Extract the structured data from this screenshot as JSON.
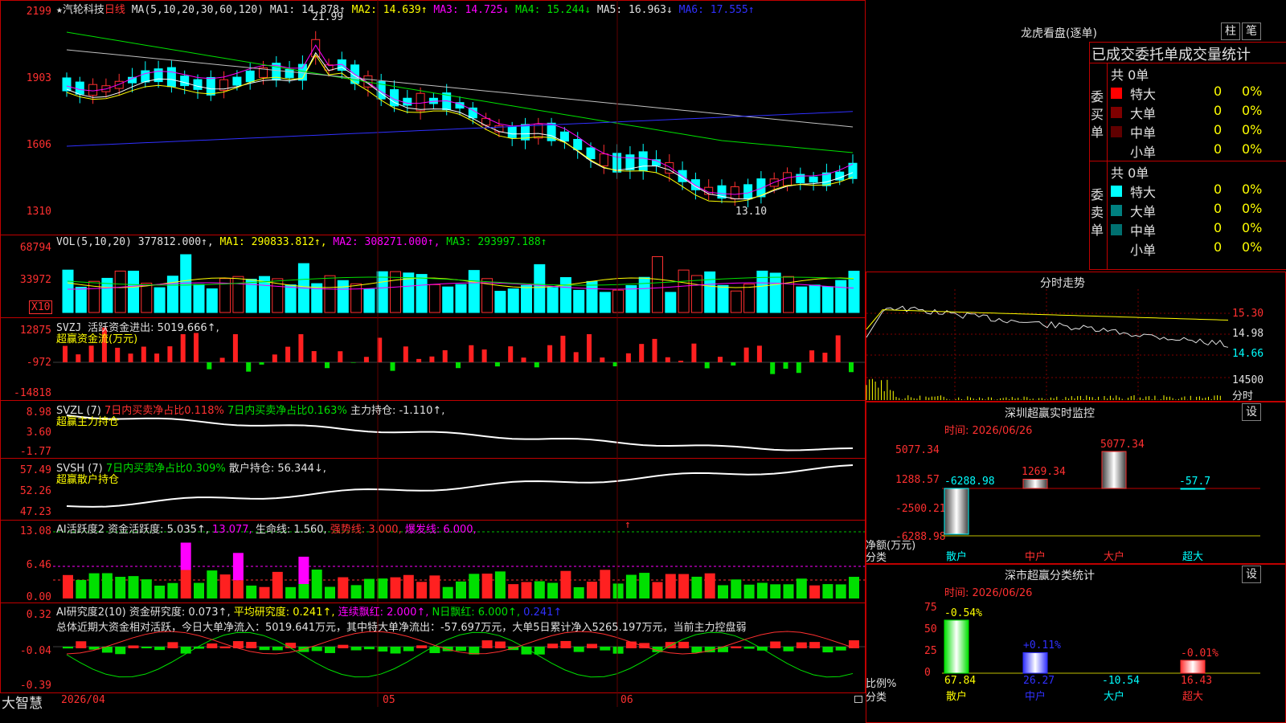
{
  "header": {
    "star": "★",
    "name": "汽轮科技",
    "period": "日线",
    "ma_label": "MA(5,10,20,30,60,120)",
    "ma1": "MA1: 14.878↑",
    "ma2": "MA2: 14.639↑",
    "ma3": "MA3: 14.725↓",
    "ma4": "MA4: 15.244↓",
    "ma5": "MA5: 16.963↓",
    "ma6": "MA6: 17.555↑"
  },
  "price_axis": [
    "2199",
    "1903",
    "1606",
    "1310"
  ],
  "price_marks": {
    "high": "21.99",
    "low": "13.10"
  },
  "vol": {
    "label": "VOL(5,10,20)",
    "value": "377812.000↑,",
    "ma1": "MA1: 290833.812↑,",
    "ma2": "MA2: 308271.000↑,",
    "ma3": "MA3: 293997.188↑",
    "axis": [
      "68794",
      "33972"
    ],
    "unit": "X10"
  },
  "svzj": {
    "label": "SVZJ",
    "title": "活跃资金进出: 5019.666↑,",
    "sub": "超赢资金流(万元)",
    "axis": [
      "12875",
      "-972",
      "-14818"
    ]
  },
  "svzl": {
    "label": "SVZL (7)",
    "buy": "7日内买卖净占比0.118%",
    "sell": "7日内买卖净占比0.163%",
    "pos": "主力持仓: -1.110↑,",
    "sub": "超赢主力持仓",
    "axis": [
      "8.98",
      "3.60",
      "-1.77"
    ]
  },
  "svsh": {
    "label": "SVSH (7)",
    "buy": "7日内买卖净占比0.309%",
    "pos": "散户持仓: 56.344↓,",
    "sub": "超赢散户持仓",
    "axis": [
      "57.49",
      "52.26",
      "47.23"
    ]
  },
  "ai1": {
    "label": "AI活跃度2",
    "a": "资金活跃度: 5.035↑,",
    "b": "13.077,",
    "c": "生命线: 1.560,",
    "d": "强势线: 3.000,",
    "e": "爆发线: 6.000,",
    "arrow": "↑",
    "axis": [
      "13.08",
      "6.46",
      "0.00"
    ]
  },
  "ai2": {
    "label": "AI研究度2(10)",
    "a": "资金研究度: 0.073↑,",
    "b": "平均研究度: 0.241↑,",
    "c": "连续飘红: 2.000↑,",
    "d": "N日飘红: 6.000↑,",
    "e": "0.241↑",
    "summary": "总体近期大资金相对活跃，今日大单净流入：5019.641万元，其中特大单净流出：-57.697万元，大单5日累计净入5265.197万元，当前主力控盘弱",
    "axis": [
      "0.32",
      "-0.04",
      "-0.39"
    ]
  },
  "bottom_bar": {
    "brand": "大智慧",
    "dates": [
      "2026/04",
      "05",
      "06"
    ]
  },
  "dragon": {
    "title": "龙虎看盘(逐单)",
    "btn1": "柱",
    "btn2": "笔",
    "subtitle": "已成交委托单成交量统计",
    "buy_label": "委买单",
    "sell_label": "委卖单",
    "buy_total": "共 0单",
    "sell_total": "共 0单",
    "buy_rows": [
      {
        "name": "特大",
        "val": "0",
        "pct": "0%",
        "color": "#ff0000"
      },
      {
        "name": "大单",
        "val": "0",
        "pct": "0%",
        "color": "#800000"
      },
      {
        "name": "中单",
        "val": "0",
        "pct": "0%",
        "color": "#600000"
      },
      {
        "name": "小单",
        "val": "0",
        "pct": "0%",
        "color": "#000000"
      }
    ],
    "sell_rows": [
      {
        "name": "特大",
        "val": "0",
        "pct": "0%",
        "color": "#00ffff"
      },
      {
        "name": "大单",
        "val": "0",
        "pct": "0%",
        "color": "#008080"
      },
      {
        "name": "中单",
        "val": "0",
        "pct": "0%",
        "color": "#007070"
      },
      {
        "name": "小单",
        "val": "0",
        "pct": "0%",
        "color": "#000000"
      }
    ]
  },
  "intraday": {
    "title": "分时走势",
    "axis": [
      "15.30",
      "14.98",
      "14.66",
      "14500"
    ],
    "unit": "分时"
  },
  "sz_monitor": {
    "title": "深圳超赢实时监控",
    "btn": "设",
    "time": "时间: 2026/06/26",
    "axis": [
      "5077.34",
      "1288.57",
      "-2500.21",
      "-6288.98"
    ],
    "ylabel": "净额(万元)",
    "xlabel": "分类",
    "cats": [
      "散户",
      "中户",
      "大户",
      "超大"
    ],
    "vals": [
      "-6288.98",
      "1269.34",
      "5077.34",
      "-57.7"
    ]
  },
  "sz_class": {
    "title": "深市超赢分类统计",
    "btn": "设",
    "time": "时间: 2026/06/26",
    "axis": [
      "75",
      "50",
      "25",
      "0"
    ],
    "ylabel": "比例%",
    "xlabel": "分类",
    "cats": [
      "散户",
      "中户",
      "大户",
      "超大"
    ],
    "tops": [
      "-0.54%",
      "+0.11%",
      "",
      "-0.01%"
    ],
    "vals": [
      "67.84",
      "26.27",
      "-10.54",
      "16.43"
    ]
  },
  "chart_data": {
    "type": "bar",
    "title": "深市超赢分类统计",
    "categories": [
      "散户",
      "中户",
      "大户",
      "超大"
    ],
    "values": [
      67.84,
      26.27,
      -10.54,
      16.43
    ],
    "ylabel": "比例%",
    "xlabel": "分类",
    "ylim": [
      0,
      75
    ]
  }
}
